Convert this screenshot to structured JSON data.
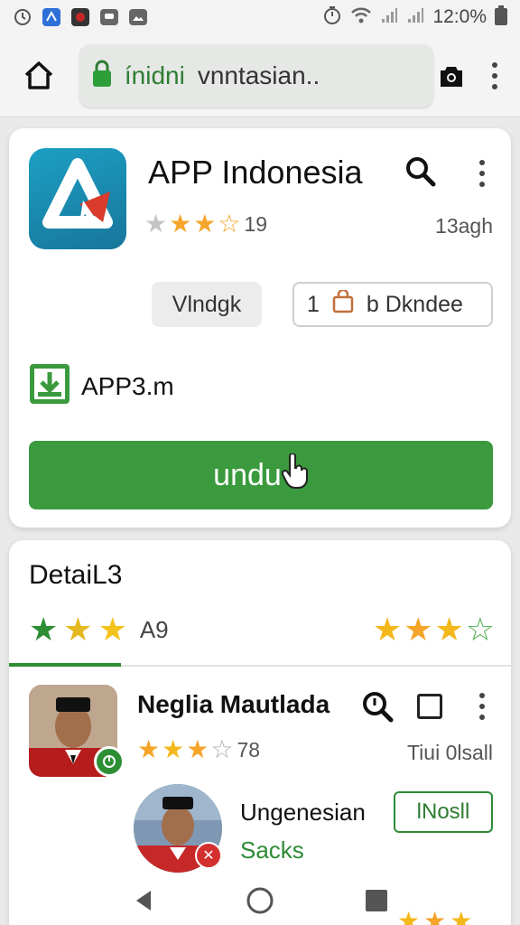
{
  "status_bar": {
    "time": "12:0%",
    "icons": [
      "alarm-icon",
      "app-notification-icon",
      "media-notification-icon",
      "message-icon",
      "gallery-icon",
      "timer-icon",
      "wifi-icon",
      "signal-icon",
      "signal-icon",
      "battery-icon"
    ]
  },
  "browser": {
    "domain": "ínidni",
    "url_rest": "vnntasian..",
    "lock_color": "#2e7d32"
  },
  "app": {
    "title": "APP Indonesia",
    "rating_count": "19",
    "rating_stars": 3.5,
    "size": "13agh",
    "chip_gray": "Vlndgk",
    "chip_outline_num": "1",
    "chip_outline_label": "b Dkndee",
    "file_name": "APP3.m",
    "download_label": "undu",
    "accent": "#3a9a3d"
  },
  "details": {
    "title": "DetaiL3",
    "tab_count": "A9",
    "entry1": {
      "title": "Neglia Mautlada",
      "rating_count": "78",
      "meta": "Tiui 0lsall"
    },
    "entry2": {
      "title": "Ungenesian",
      "sub": "Sacks",
      "button": "lNosll"
    }
  },
  "nav": {
    "icons": [
      "back-icon",
      "home-circle-icon",
      "recents-icon"
    ]
  }
}
